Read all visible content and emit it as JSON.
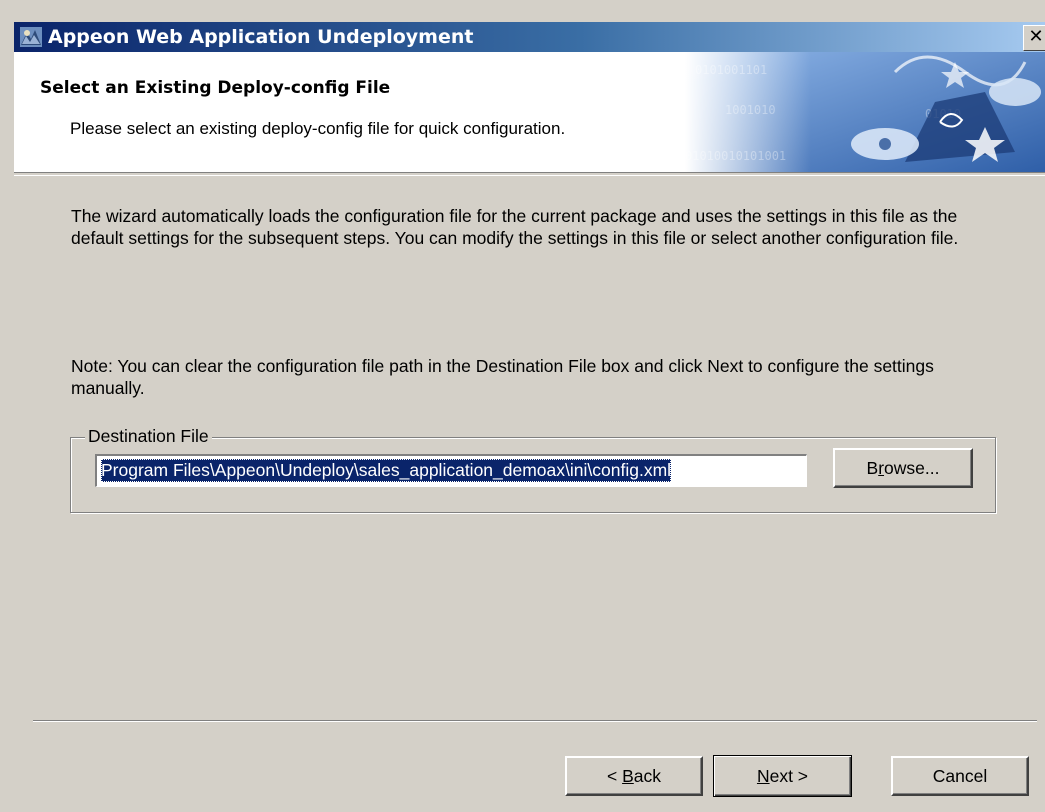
{
  "window": {
    "title": "Appeon Web Application Undeployment",
    "close_glyph": "✕"
  },
  "header": {
    "title": "Select an Existing Deploy-config File",
    "subtitle": "Please select an existing deploy-config file for quick configuration."
  },
  "body": {
    "paragraph1": "The wizard automatically loads the configuration file for the current package and uses the settings in this file as the default settings for the subsequent steps. You can modify the settings in this file or select another configuration file.",
    "paragraph2": "Note: You can clear the configuration file path in the Destination File box and click Next to configure the settings manually."
  },
  "destination": {
    "group_label": "Destination File",
    "value": "Program Files\\Appeon\\Undeploy\\sales_application_demoax\\ini\\config.xml",
    "browse_pre": "B",
    "browse_ul": "r",
    "browse_post": "owse..."
  },
  "buttons": {
    "back_pre": "< ",
    "back_ul": "B",
    "back_post": "ack",
    "next_ul": "N",
    "next_post": "ext >",
    "cancel": "Cancel"
  },
  "colors": {
    "titlebar_start": "#0a246a",
    "titlebar_end": "#a6caf0",
    "dialog_face": "#d4d0c8",
    "selection": "#0a246a"
  },
  "icons": {
    "app": "appeon-app-icon",
    "close": "close-icon",
    "header_art": "wizard-banner-art"
  }
}
